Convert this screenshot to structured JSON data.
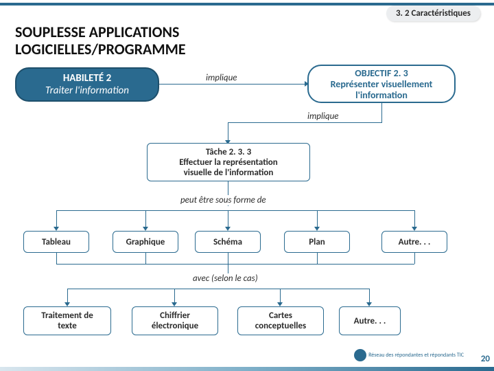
{
  "section_badge": "3. 2 Caractéristiques",
  "title_line1": "SOUPLESSE APPLICATIONS",
  "title_line2": "LOGICIELLES/PROGRAMME",
  "habilete": {
    "line1": "HABILETÉ 2",
    "line2": "Traiter l'information"
  },
  "objectif": {
    "line1": "OBJECTIF 2. 3",
    "line2": "Représenter visuellement l'information"
  },
  "implique1": "implique",
  "implique2": "implique",
  "tache": {
    "line1": "Tâche 2. 3. 3",
    "line2": "Effectuer la représentation",
    "line3": "visuelle de l'information"
  },
  "peut_etre": "peut être sous forme de",
  "formats": [
    "Tableau",
    "Graphique",
    "Schéma",
    "Plan",
    "Autre. . ."
  ],
  "avec": "avec (selon le cas)",
  "tools": [
    {
      "l1": "Traitement de",
      "l2": "texte"
    },
    {
      "l1": "Chiffrier",
      "l2": "électronique"
    },
    {
      "l1": "Cartes",
      "l2": "conceptuelles"
    },
    {
      "l1": "Autre. . .",
      "l2": ""
    }
  ],
  "footer_org": "Réseau des répondantes\net répondants TIC",
  "page_number": "20"
}
